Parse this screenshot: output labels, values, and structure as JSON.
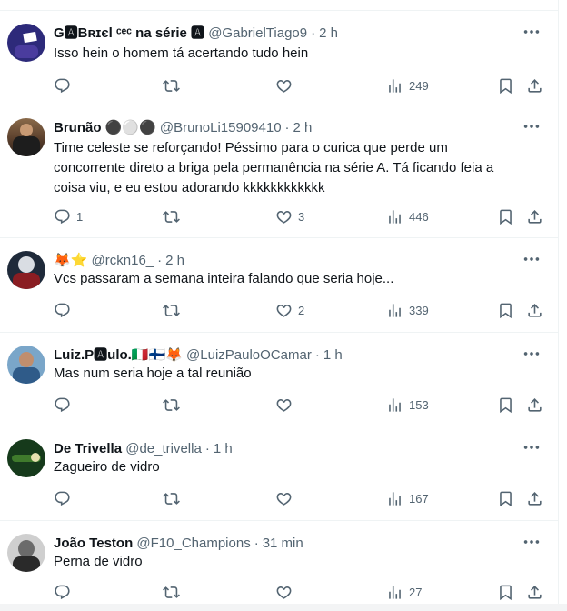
{
  "tweets": [
    {
      "name": "G🅰Bʀɪєl ᶜᵉᶜ na série 🅰",
      "handle": "@GabrielTiago9",
      "time": "2 h",
      "text": "Isso hein o homem tá acertando tudo hein",
      "replies": "",
      "retweets": "",
      "likes": "",
      "views": "249"
    },
    {
      "name": "Brunão ⚫⚪⚫",
      "handle": "@BrunoLi15909410",
      "time": "2 h",
      "text": "Time celeste se reforçando! Péssimo para o curica que perde um\nconcorrente direto a briga pela permanência na série A. Tá ficando feia a\ncoisa viu, e eu estou adorando kkkkkkkkkkkk",
      "replies": "1",
      "retweets": "",
      "likes": "3",
      "views": "446"
    },
    {
      "name": "🦊⭐",
      "handle": "@rckn16_",
      "time": "2 h",
      "text": "Vcs passaram a semana inteira falando que seria hoje...",
      "replies": "",
      "retweets": "",
      "likes": "2",
      "views": "339"
    },
    {
      "name": "Luiz.P🅰ulo.🇮🇹🇫🇮🦊",
      "handle": "@LuizPauloOCamar",
      "time": "1 h",
      "text": "Mas num seria hoje a tal reunião",
      "replies": "",
      "retweets": "",
      "likes": "",
      "views": "153"
    },
    {
      "name": "De Trivella",
      "handle": "@de_trivella",
      "time": "1 h",
      "text": "Zagueiro de vidro",
      "replies": "",
      "retweets": "",
      "likes": "",
      "views": "167"
    },
    {
      "name": "João Teston",
      "handle": "@F10_Champions",
      "time": "31 min",
      "text": "Perna de vidro",
      "replies": "",
      "retweets": "",
      "likes": "",
      "views": "27"
    }
  ],
  "icons": {
    "reply": "reply-icon",
    "retweet": "retweet-icon",
    "like": "heart-icon",
    "views": "views-chart-icon",
    "bookmark": "bookmark-icon",
    "share": "share-icon",
    "more": "more-dots-icon"
  },
  "colors": {
    "text": "#0f1419",
    "secondary": "#536471",
    "divider": "#eff3f4",
    "badge_red": "#e0245e"
  }
}
